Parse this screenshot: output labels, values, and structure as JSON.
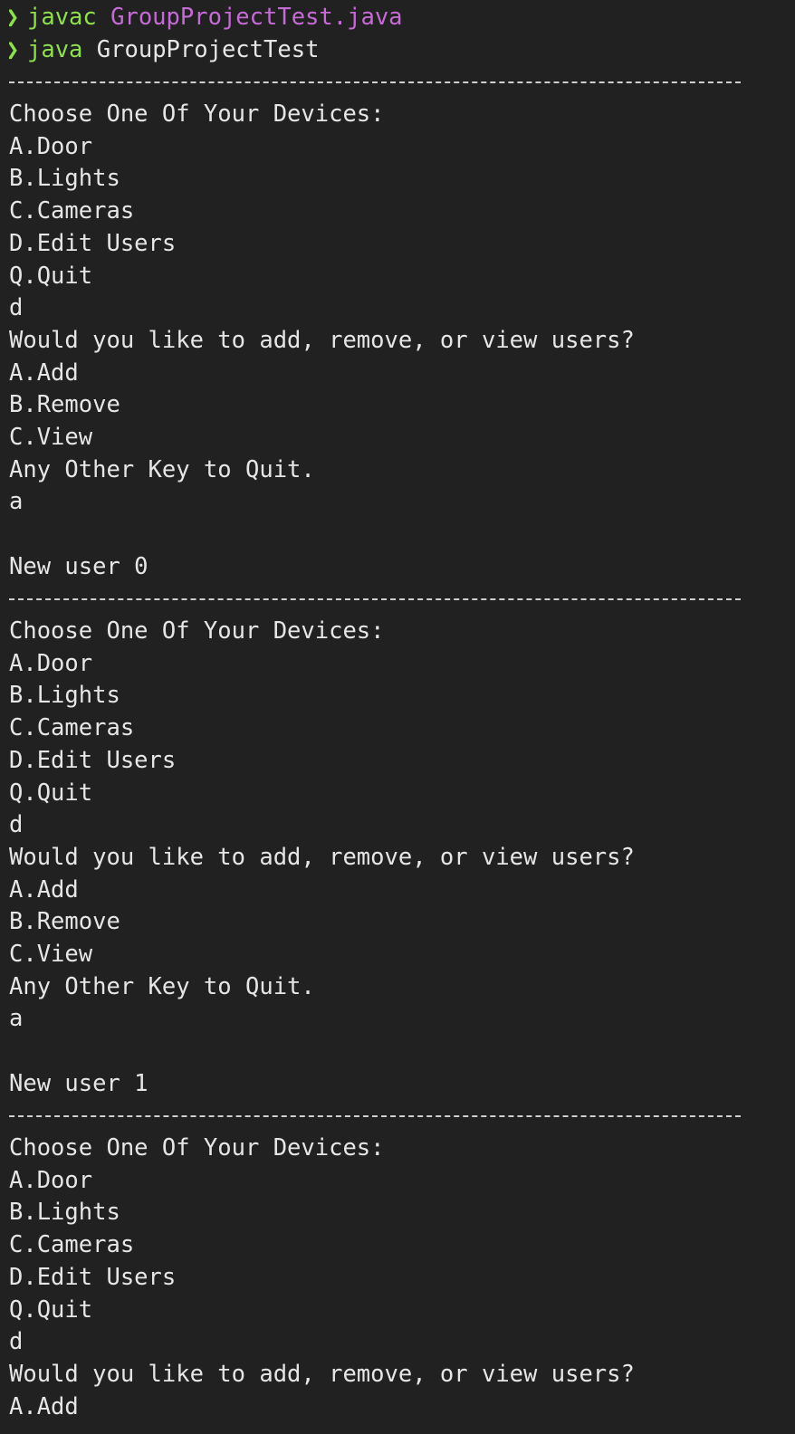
{
  "terminal": {
    "commands": [
      {
        "prompt": "❯",
        "cmd": "javac",
        "arg": "GroupProjectTest.java"
      },
      {
        "prompt": "❯",
        "cmd": "java",
        "arg": "GroupProjectTest"
      }
    ],
    "colors": {
      "background": "#212121",
      "text": "#e6e6e6",
      "green": "#8ee04f",
      "magenta": "#c66bd6",
      "blue": "#4da3ff"
    },
    "lines": [
      {
        "type": "sep"
      },
      {
        "text": "Choose One Of Your Devices:"
      },
      {
        "text": "A.Door"
      },
      {
        "text": "B.Lights"
      },
      {
        "text": "C.Cameras"
      },
      {
        "text": "D.Edit Users"
      },
      {
        "text": "Q.Quit"
      },
      {
        "text": "d"
      },
      {
        "text": "Would you like to add, remove, or view users?"
      },
      {
        "text": "A.Add"
      },
      {
        "text": "B.Remove"
      },
      {
        "text": "C.View"
      },
      {
        "text": "Any Other Key to Quit."
      },
      {
        "text": "a"
      },
      {
        "text": ""
      },
      {
        "text": "New user 0"
      },
      {
        "type": "sep"
      },
      {
        "text": "Choose One Of Your Devices:"
      },
      {
        "text": "A.Door"
      },
      {
        "text": "B.Lights"
      },
      {
        "text": "C.Cameras"
      },
      {
        "text": "D.Edit Users"
      },
      {
        "text": "Q.Quit"
      },
      {
        "text": "d"
      },
      {
        "text": "Would you like to add, remove, or view users?"
      },
      {
        "text": "A.Add"
      },
      {
        "text": "B.Remove"
      },
      {
        "text": "C.View"
      },
      {
        "text": "Any Other Key to Quit."
      },
      {
        "text": "a"
      },
      {
        "text": ""
      },
      {
        "text": "New user 1"
      },
      {
        "type": "sep"
      },
      {
        "text": "Choose One Of Your Devices:"
      },
      {
        "text": "A.Door"
      },
      {
        "text": "B.Lights"
      },
      {
        "text": "C.Cameras"
      },
      {
        "text": "D.Edit Users"
      },
      {
        "text": "Q.Quit"
      },
      {
        "text": "d"
      },
      {
        "text": "Would you like to add, remove, or view users?"
      },
      {
        "text": "A.Add"
      }
    ]
  }
}
